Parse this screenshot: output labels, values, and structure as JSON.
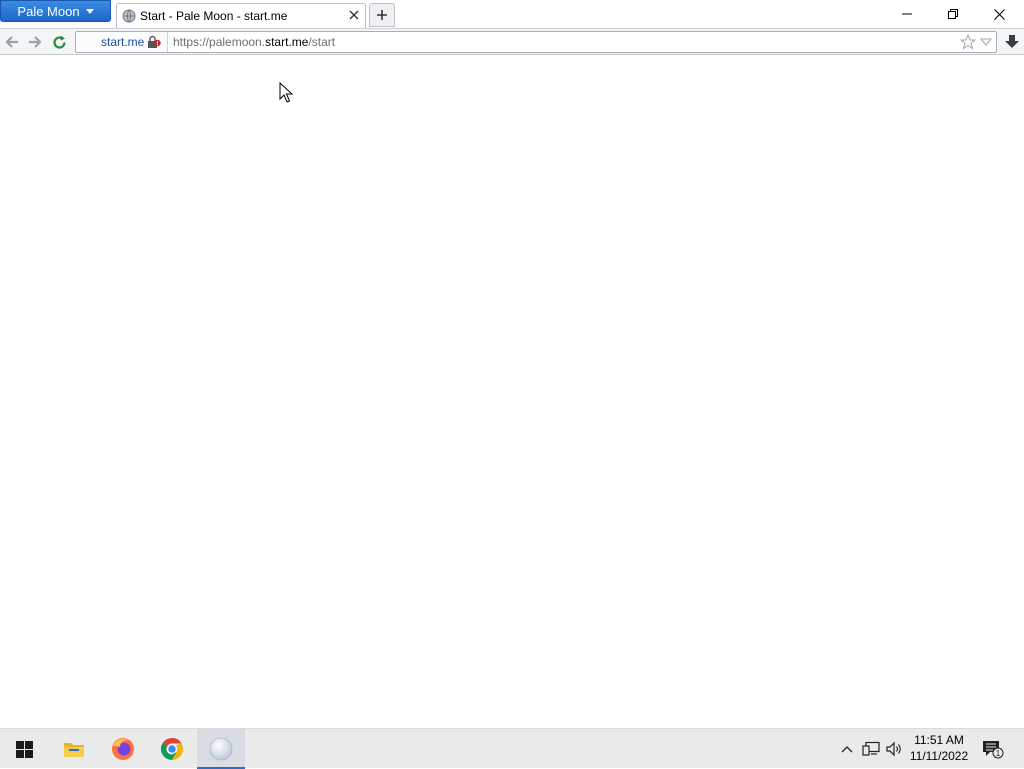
{
  "browser": {
    "app_menu_label": "Pale Moon",
    "tab": {
      "title": "Start - Pale Moon - start.me",
      "favicon": "globe-icon"
    },
    "new_tab_icon": "plus-icon",
    "window_controls": [
      "minimize-icon",
      "restore-icon",
      "close-icon"
    ]
  },
  "navbar": {
    "identity_label": "start.me",
    "url": {
      "scheme": "https://palemoon.",
      "domain": "start.me",
      "path": "/start"
    }
  },
  "taskbar": {
    "apps": [
      {
        "name": "Start",
        "icon": "windows-logo-icon"
      },
      {
        "name": "File Explorer",
        "icon": "folder-icon"
      },
      {
        "name": "Firefox",
        "icon": "firefox-icon"
      },
      {
        "name": "Google Chrome",
        "icon": "chrome-icon"
      },
      {
        "name": "Pale Moon",
        "icon": "palemoon-icon",
        "active": true
      }
    ],
    "clock": {
      "time": "11:51 AM",
      "date": "11/11/2022"
    },
    "notification_count": "1"
  },
  "colors": {
    "app_menu": "#1c66c8",
    "taskbar": "#eaeaea",
    "active_indicator": "#2b6fcb"
  }
}
